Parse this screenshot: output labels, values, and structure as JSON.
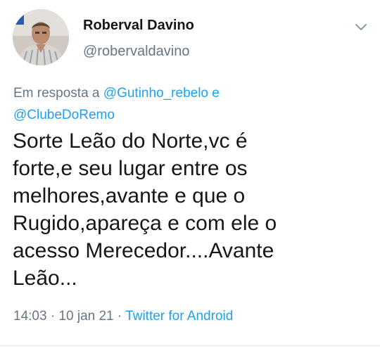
{
  "tweet": {
    "author": {
      "display_name": "Roberval Davino",
      "handle": "@robervaldavino",
      "avatar_icon": "profile-photo"
    },
    "menu_icon": "chevron-down-icon",
    "reply_to": {
      "prefix": "Em resposta a",
      "mention_1": "@Gutinho_rebelo",
      "conjunction": "e",
      "mention_2": "@ClubeDoRemo"
    },
    "text": "Sorte Leão do Norte,vc é\nforte,e seu lugar entre os\nmelhores,avante e que o\nRugido,apareça e com ele o\nacesso Merecedor....Avante\nLeão...",
    "meta": {
      "time": "14:03",
      "separator_1": "·",
      "date": "10 jan 21",
      "separator_2": "·",
      "source": "Twitter for Android"
    }
  },
  "colors": {
    "text": "#14171a",
    "secondary": "#657786",
    "link": "#1da1f2",
    "divider": "#e1e8ed"
  }
}
